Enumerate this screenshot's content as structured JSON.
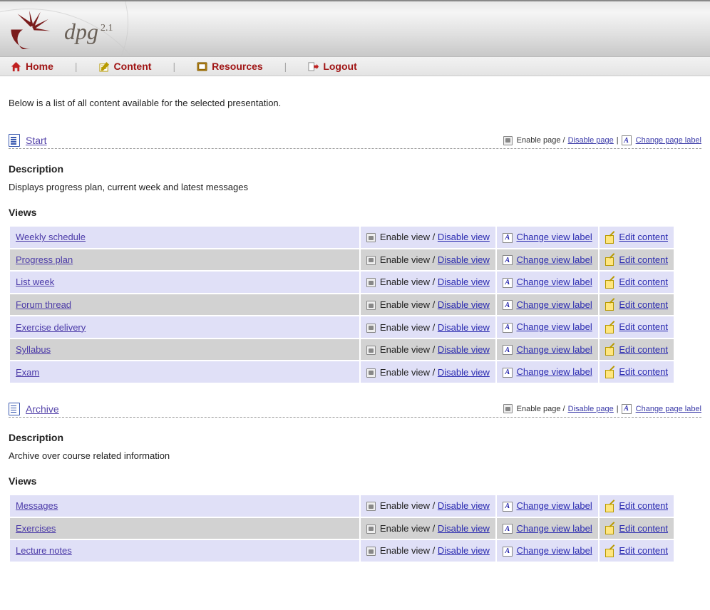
{
  "brand": {
    "name": "dpg",
    "version": "2.1"
  },
  "nav": {
    "home": "Home",
    "content": "Content",
    "resources": "Resources",
    "logout": "Logout"
  },
  "intro": "Below is a list of all content available for the selected presentation.",
  "labels": {
    "description": "Description",
    "views": "Views",
    "enable_page": "Enable page /",
    "disable_page": "Disable page",
    "change_page_label": "Change page label",
    "enable_view": "Enable view /",
    "disable_view": "Disable view",
    "change_view_label": "Change view label",
    "edit_content": "Edit content",
    "sep": "|"
  },
  "sections": [
    {
      "title": "Start",
      "description": "Displays progress plan, current week and latest messages",
      "views": [
        {
          "name": "Weekly schedule"
        },
        {
          "name": "Progress plan"
        },
        {
          "name": "List week"
        },
        {
          "name": "Forum thread"
        },
        {
          "name": "Exercise delivery"
        },
        {
          "name": "Syllabus"
        },
        {
          "name": "Exam"
        }
      ]
    },
    {
      "title": "Archive",
      "description": "Archive over course related information",
      "views": [
        {
          "name": "Messages"
        },
        {
          "name": "Exercises"
        },
        {
          "name": "Lecture notes"
        }
      ]
    }
  ]
}
